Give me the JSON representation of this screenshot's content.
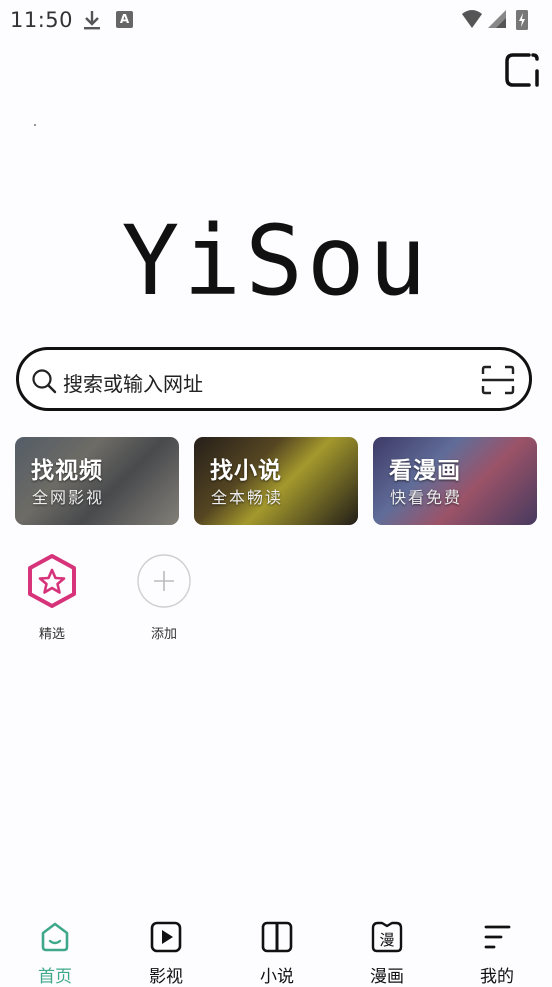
{
  "status_bar": {
    "time": "11:50",
    "notification_badge": "A"
  },
  "logo": {
    "text": "YiSou"
  },
  "search": {
    "placeholder": "搜索或输入网址"
  },
  "cards": [
    {
      "title": "找视频",
      "subtitle": "全网影视"
    },
    {
      "title": "找小说",
      "subtitle": "全本畅读"
    },
    {
      "title": "看漫画",
      "subtitle": "快看免费"
    }
  ],
  "shortcuts": [
    {
      "label": "精选",
      "icon": "star-hexagon-icon"
    },
    {
      "label": "添加",
      "icon": "plus-circle-icon"
    }
  ],
  "nav": [
    {
      "label": "首页",
      "icon": "home-icon",
      "active": true
    },
    {
      "label": "影视",
      "icon": "play-icon",
      "active": false
    },
    {
      "label": "小说",
      "icon": "book-icon",
      "active": false
    },
    {
      "label": "漫画",
      "icon": "comic-icon",
      "active": false,
      "icon_text": "漫"
    },
    {
      "label": "我的",
      "icon": "menu-lines-icon",
      "active": false
    }
  ],
  "colors": {
    "accent": "#3fa88a",
    "featured": "#d6337a"
  }
}
